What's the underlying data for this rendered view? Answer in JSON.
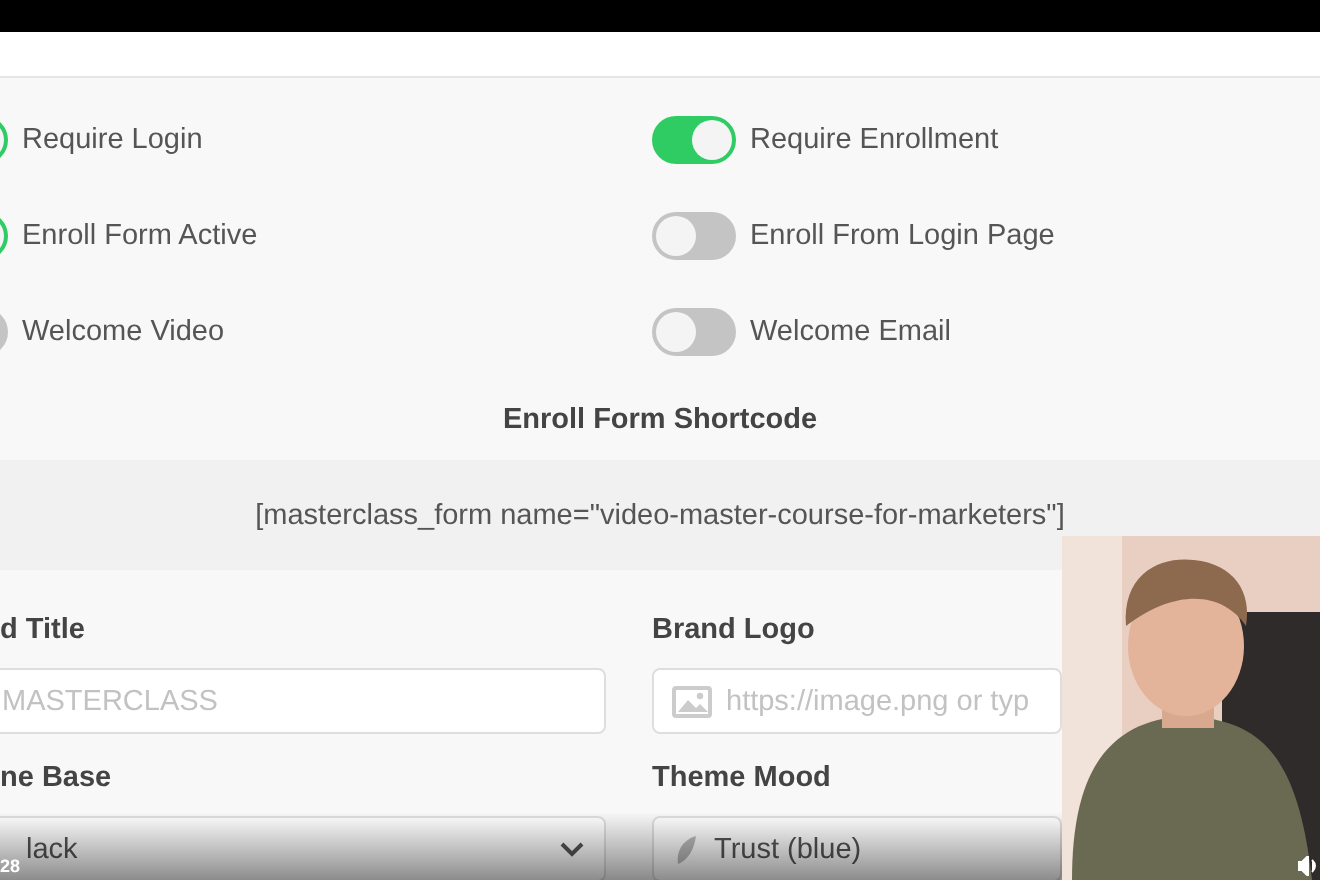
{
  "settings_toggles": [
    {
      "label": "Require Login",
      "on": true
    },
    {
      "label": "Require Enrollment",
      "on": true
    },
    {
      "label": "Enroll Form Active",
      "on": true
    },
    {
      "label": "Enroll From Login Page",
      "on": false
    },
    {
      "label": "Welcome Video",
      "on": false
    },
    {
      "label": "Welcome Email",
      "on": false
    }
  ],
  "shortcode": {
    "heading": "Enroll Form Shortcode",
    "code": "[masterclass_form name=\"video-master-course-for-marketers\"]"
  },
  "fields": [
    {
      "label": "d Title",
      "kind": "text",
      "placeholder": "MASTERCLASS"
    },
    {
      "label": "Brand Logo",
      "kind": "image-url",
      "placeholder": "https://image.png or typ"
    },
    {
      "label": "ne Base",
      "kind": "select",
      "value": "lack"
    },
    {
      "label": "Theme Mood",
      "kind": "select-swatch",
      "value": "Trust (blue)"
    }
  ],
  "video_player": {
    "time": "28"
  }
}
